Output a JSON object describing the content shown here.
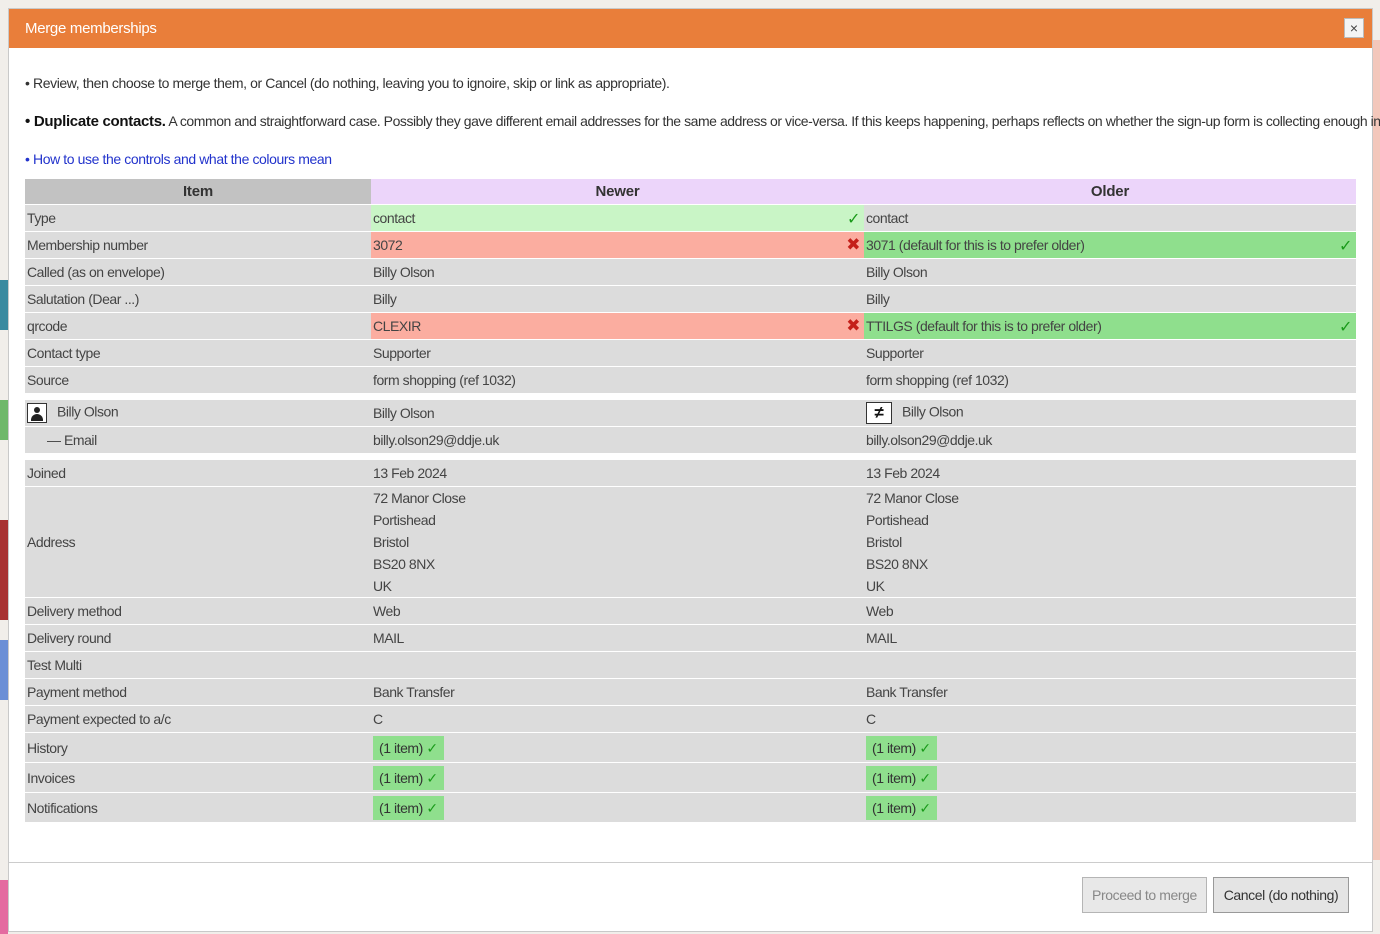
{
  "dialog": {
    "title": "Merge memberships",
    "close_label": "×"
  },
  "intro": "• Review, then choose to merge them, or Cancel (do nothing, leaving you to ignoire, skip or link as appropriate).",
  "duplicate": {
    "bold": "• Duplicate contacts.",
    "text": " A common and straightforward case. Possibly they gave different email addresses for the same address or vice-versa. If this keeps happening, perhaps reflects on whether the sign-up form is collecting enough information?"
  },
  "howto_link": "• How to use the controls and what the colours mean",
  "table": {
    "headers": {
      "item": "Item",
      "newer": "Newer",
      "older": "Older"
    },
    "type": {
      "label": "Type",
      "newer": "contact",
      "older": "contact"
    },
    "membership": {
      "label": "Membership number",
      "newer": "3072",
      "older": "3071 (default for this is to prefer older)"
    },
    "called": {
      "label": "Called (as on envelope)",
      "newer": "Billy Olson",
      "older": "Billy Olson"
    },
    "salutation": {
      "label": "Salutation (Dear ...)",
      "newer": "Billy",
      "older": "Billy"
    },
    "qrcode": {
      "label": "qrcode",
      "newer": "CLEXIR",
      "older": "TTILGS (default for this is to prefer older)"
    },
    "contact_type": {
      "label": "Contact type",
      "newer": "Supporter",
      "older": "Supporter"
    },
    "source": {
      "label": "Source",
      "newer": "form shopping (ref 1032)",
      "older": "form shopping (ref 1032)"
    },
    "person": {
      "label": "Billy Olson",
      "newer": "Billy Olson",
      "older": "Billy Olson"
    },
    "email": {
      "label": "— Email",
      "newer": "billy.olson29@ddje.uk",
      "older": "billy.olson29@ddje.uk"
    },
    "joined": {
      "label": "Joined",
      "newer": "13 Feb 2024",
      "older": "13 Feb 2024"
    },
    "address": {
      "label": "Address",
      "newer": [
        "72 Manor Close",
        "Portishead",
        "Bristol",
        "BS20 8NX",
        "UK"
      ],
      "older": [
        "72 Manor Close",
        "Portishead",
        "Bristol",
        "BS20 8NX",
        "UK"
      ]
    },
    "delivery_method": {
      "label": "Delivery method",
      "newer": "Web",
      "older": "Web"
    },
    "delivery_round": {
      "label": "Delivery round",
      "newer": "MAIL",
      "older": "MAIL"
    },
    "test_multi": {
      "label": "Test Multi",
      "newer": "",
      "older": ""
    },
    "payment_method": {
      "label": "Payment method",
      "newer": "Bank Transfer",
      "older": "Bank Transfer"
    },
    "payment_account": {
      "label": "Payment expected to a/c",
      "newer": "C",
      "older": "C"
    },
    "history": {
      "label": "History",
      "newer": "(1 item)",
      "older": "(1 item)"
    },
    "invoices": {
      "label": "Invoices",
      "newer": "(1 item)",
      "older": "(1 item)"
    },
    "notifications": {
      "label": "Notifications",
      "newer": "(1 item)",
      "older": "(1 item)"
    }
  },
  "symbols": {
    "tick": "✓",
    "cross": "✖",
    "not_equal": "≠"
  },
  "buttons": {
    "proceed": "Proceed to merge",
    "cancel": "Cancel (do nothing)"
  },
  "colors": {
    "titlebar": "#e97e3a",
    "header_item": "#c2c2c2",
    "header_version": "#ecd5fa",
    "cell": "#dcdcdc",
    "chosen_light": "#c9f5c6",
    "chosen": "#8fdf8d",
    "rejected": "#fbada0",
    "link": "#2233cc"
  }
}
